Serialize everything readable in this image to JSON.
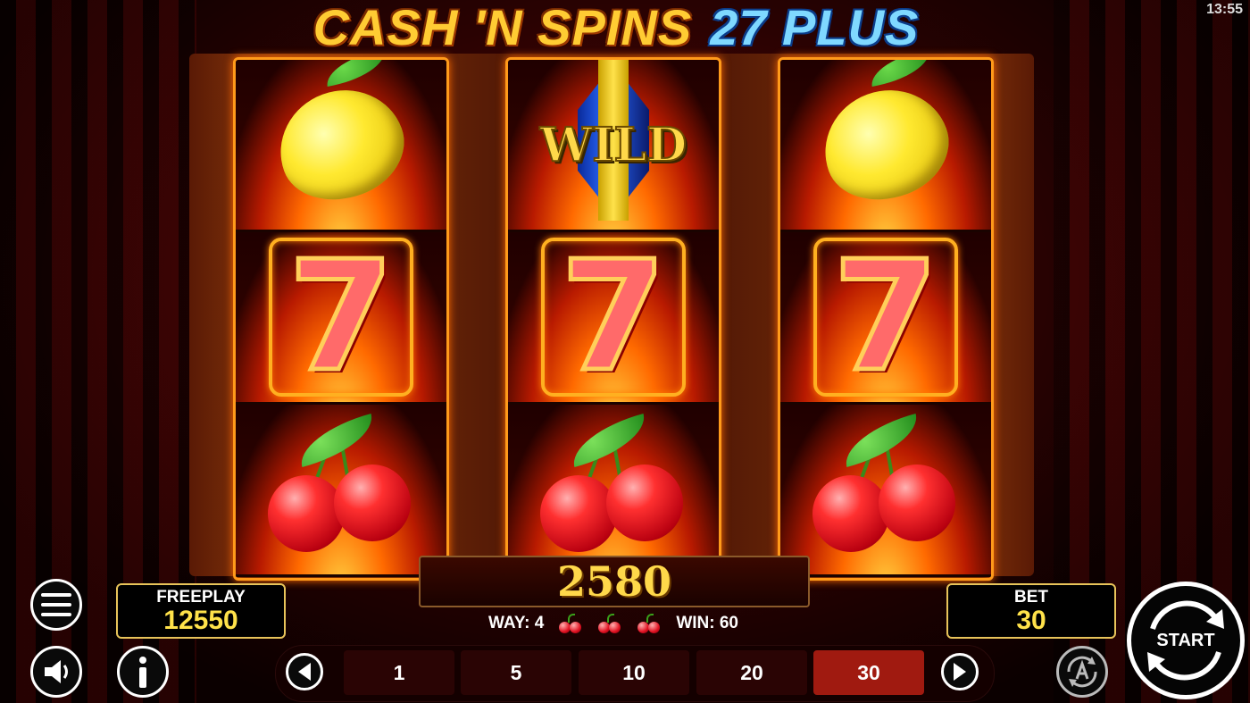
{
  "clock": "13:55",
  "title": {
    "part1": "CASH 'N SPINS",
    "part2": "27 PLUS"
  },
  "reels": [
    [
      "lemon",
      "seven",
      "cherry"
    ],
    [
      "wild",
      "seven",
      "cherry"
    ],
    [
      "lemon",
      "seven",
      "cherry"
    ]
  ],
  "symbols": {
    "seven_text": "7",
    "wild_text": "WILD"
  },
  "win_display": {
    "amount": "2580"
  },
  "win_line": {
    "way_label": "WAY: 4",
    "win_label": "WIN: 60",
    "symbol_icons": [
      "cherry-icon",
      "cherry-icon",
      "cherry-icon"
    ]
  },
  "freeplay": {
    "label": "FREEPLAY",
    "value": "12550"
  },
  "bet": {
    "label": "BET",
    "value": "30"
  },
  "bet_options": [
    "1",
    "5",
    "10",
    "20",
    "30"
  ],
  "selected_bet": "30",
  "start_button": {
    "label": "START"
  },
  "colors": {
    "accent_gold": "#ffe24a",
    "active_bet": "#a01a10",
    "reel_border": "#ff9a1a"
  },
  "icons": {
    "menu": "hamburger-menu-icon",
    "sound": "speaker-icon",
    "info": "info-icon",
    "autoplay": "autoplay-icon",
    "prev": "chevron-left-icon",
    "next": "chevron-right-icon"
  }
}
